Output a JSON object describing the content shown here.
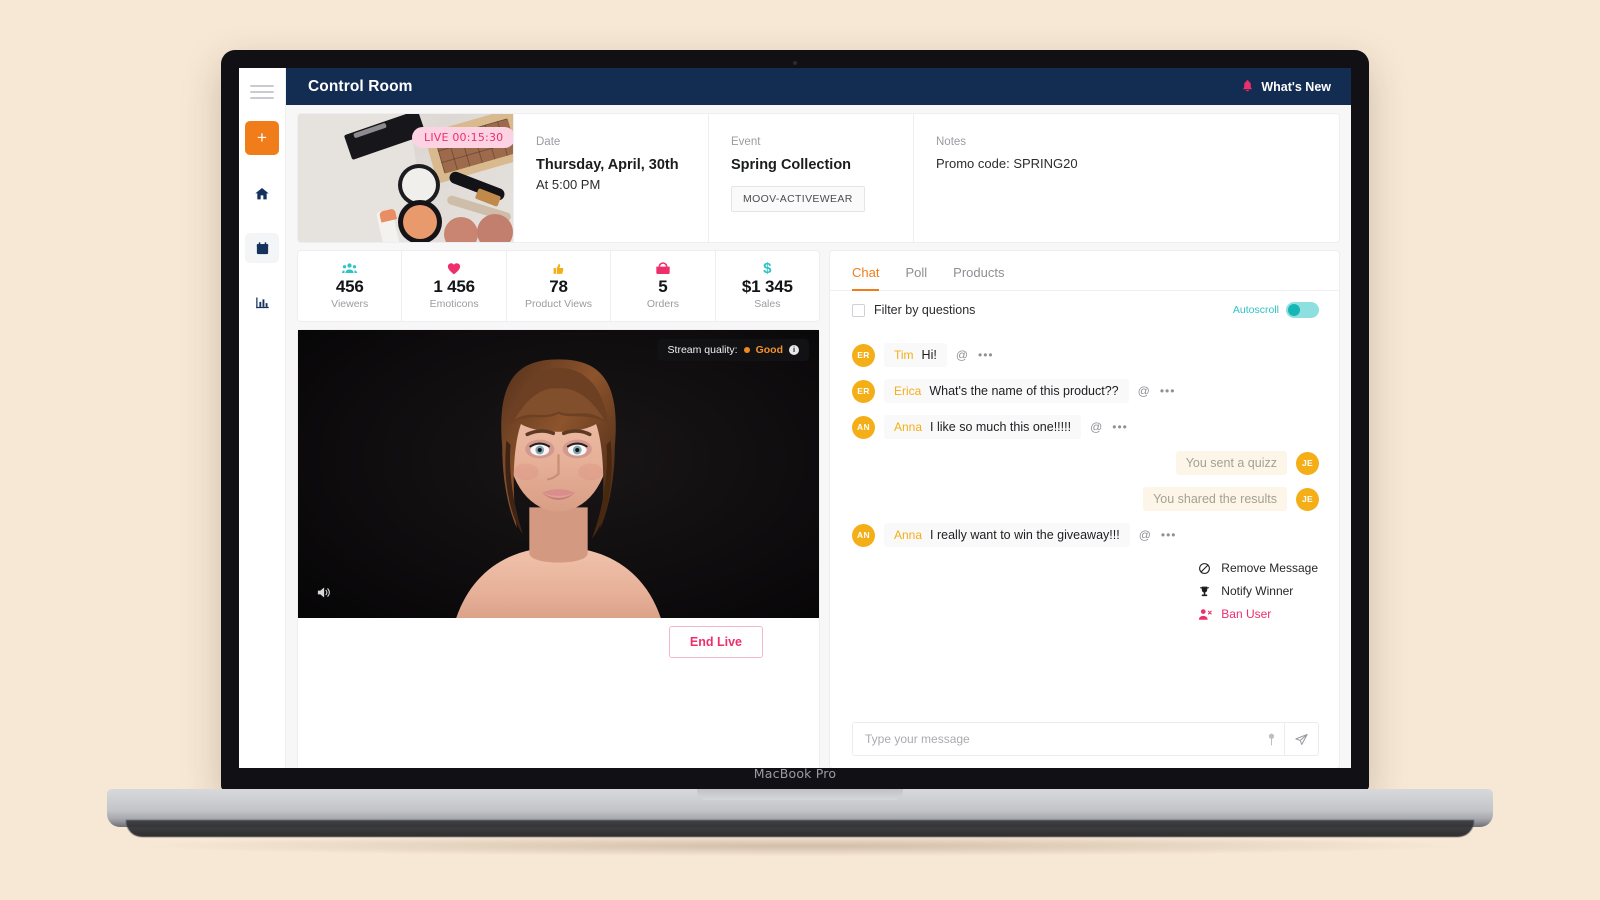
{
  "device": {
    "brand": "MacBook Pro"
  },
  "topbar": {
    "title": "Control Room",
    "whats_new": "What's New",
    "bell_icon": "bell-icon",
    "bg_color": "#132c52"
  },
  "sidebar": {
    "hamburger_icon": "hamburger-icon",
    "add_label": "+",
    "items": [
      {
        "icon": "home-icon",
        "active": false
      },
      {
        "icon": "calendar-icon",
        "active": true
      },
      {
        "icon": "bar-chart-icon",
        "active": false
      }
    ],
    "accent_color": "#f07d1a"
  },
  "event": {
    "live_badge": "LIVE 00:15:30",
    "live_badge_bg": "#fbd3e3",
    "live_badge_color": "#ef2f6b",
    "date": {
      "label": "Date",
      "main": "Thursday, April, 30th",
      "sub": "At 5:00 PM"
    },
    "name": {
      "label": "Event",
      "main": "Spring Collection",
      "tag": "MOOV-ACTIVEWEAR"
    },
    "notes": {
      "label": "Notes",
      "main": "Promo code: SPRING20"
    }
  },
  "stats": [
    {
      "icon": "group-icon",
      "glyph": "👥",
      "value": "456",
      "label": "Viewers",
      "color": "#2ec4c4"
    },
    {
      "icon": "heart-icon",
      "glyph": "❤",
      "value": "1 456",
      "label": "Emoticons",
      "color": "#ef2f6b"
    },
    {
      "icon": "thumbs-up-icon",
      "glyph": "👍",
      "value": "78",
      "label": "Product Views",
      "color": "#f4ae17"
    },
    {
      "icon": "shopping-bag-icon",
      "glyph": "🛍",
      "value": "5",
      "label": "Orders",
      "color": "#ef2f6b"
    },
    {
      "icon": "dollar-icon",
      "glyph": "$",
      "value": "$1 345",
      "label": "Sales",
      "color": "#2ec4c4"
    }
  ],
  "video": {
    "stream_quality_label": "Stream quality:",
    "stream_quality_value": "Good",
    "stream_quality_color": "#f2912a",
    "info_glyph": "i",
    "mute_icon": "speaker-icon",
    "end_live_label": "End Live",
    "end_live_color": "#ef2f6b"
  },
  "chat": {
    "tabs": [
      {
        "label": "Chat",
        "active": true
      },
      {
        "label": "Poll",
        "active": false
      },
      {
        "label": "Products",
        "active": false
      }
    ],
    "filter_label": "Filter by questions",
    "filter_checked": false,
    "autoscroll_label": "Autoscroll",
    "autoscroll_on": true,
    "autoscroll_color": "#2ec4c4",
    "messages": [
      {
        "dir": "in",
        "avatar": "ER",
        "name": "Tim",
        "text": "Hi!",
        "at": "@",
        "dots": "•••"
      },
      {
        "dir": "in",
        "avatar": "ER",
        "name": "Erica",
        "text": "What's the name of this product??",
        "at": "@",
        "dots": "•••"
      },
      {
        "dir": "in",
        "avatar": "AN",
        "name": "Anna",
        "text": "I like so much this one!!!!!",
        "at": "@",
        "dots": "•••"
      },
      {
        "dir": "out",
        "avatar": "JE",
        "name": "",
        "text": "You sent a quizz",
        "at": "",
        "dots": ""
      },
      {
        "dir": "out",
        "avatar": "JE",
        "name": "",
        "text": "You shared the results",
        "at": "",
        "dots": ""
      },
      {
        "dir": "in",
        "avatar": "AN",
        "name": "Anna",
        "text": "I really want to win the giveaway!!!",
        "at": "@",
        "dots": "•••"
      }
    ],
    "context_menu": [
      {
        "icon": "block-icon",
        "label": "Remove Message",
        "danger": false
      },
      {
        "icon": "trophy-icon",
        "label": "Notify Winner",
        "danger": false
      },
      {
        "icon": "ban-user-icon",
        "label": "Ban User",
        "danger": true
      }
    ],
    "composer": {
      "value": "",
      "placeholder": "Type your message",
      "pin_icon": "pin-icon",
      "send_icon": "send-icon"
    }
  }
}
